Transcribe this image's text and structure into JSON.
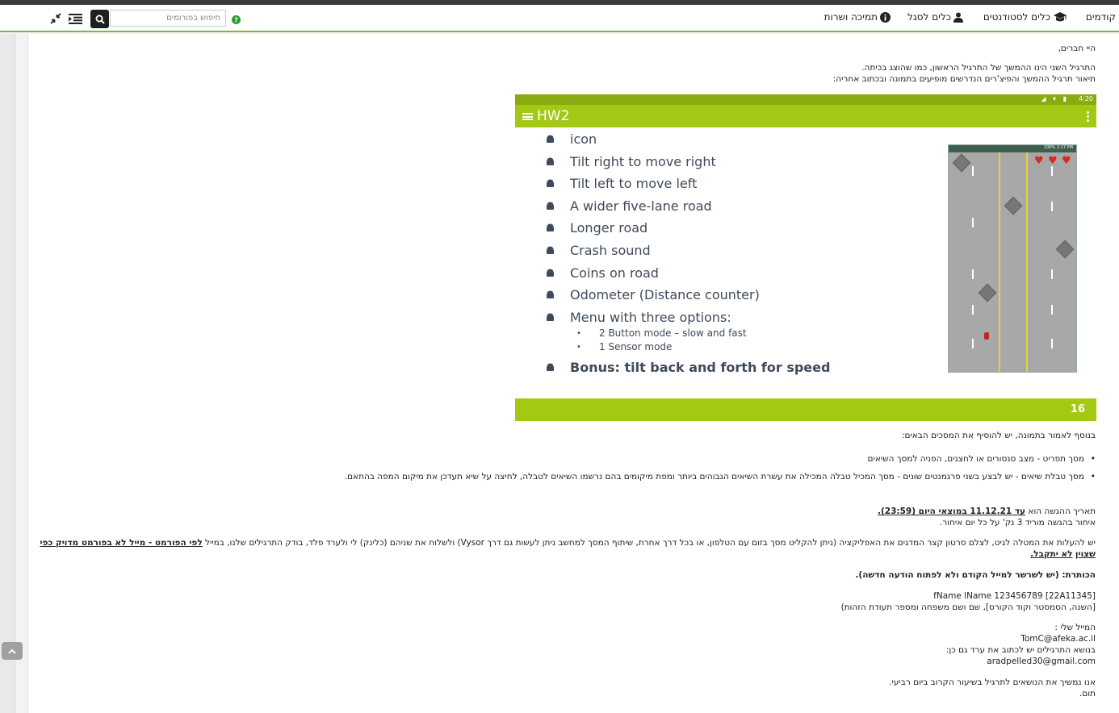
{
  "nav": {
    "items": [
      {
        "label": "קודמים"
      },
      {
        "label": "כלים לסטודנטים"
      },
      {
        "label": "כלים לסגל"
      },
      {
        "label": "תמיכה ושרות"
      }
    ],
    "search_placeholder": "חיפוש בפורומים"
  },
  "post": {
    "greeting": "היי חברים,",
    "intro_1": "התרגיל השני הינו ההמשך של התרגיל הראשון, כמו שהוצג בכיתה.",
    "intro_2": "תיאור תרגיל ההמשך והפיצ'רים הנדרשים מופיעים בתמונה ובכתוב אחריה:",
    "slide": {
      "status_time": "4:20",
      "title": "HW2",
      "bullets": [
        "icon",
        "Tilt right to move right",
        "Tilt left to move left",
        "A wider five-lane road",
        "Longer road",
        "Crash sound",
        "Coins on road",
        "Odometer (Distance counter)",
        "Menu with three options:"
      ],
      "sub_bullets": [
        "2 Button mode – slow and fast",
        "1 Sensor mode"
      ],
      "bonus": "Bonus: tilt back and forth for speed",
      "phone_status": "100% 2:17 PM",
      "page_number": "16"
    },
    "additional_intro": "בנוסף לאמור בתמונה, יש להוסיף את המסכים הבאים:",
    "list": [
      "מסך תפריט - מצב סנסורים או לחצנים, הפניה למסך השיאים",
      "מסך טבלת שיאים - יש לבצע בשני פרגמנטים שונים - מסך המכיל טבלה המכילה את עשרת השיאים הגבוהים ביותר ומפת מיקומים בהם נרשמו השיאים לטבלה, לחיצה על שיא תעדכן את מיקום המפה בהתאם."
    ],
    "deadline_prefix": "תאריך ההגשה הוא",
    "deadline_value": "עד 11.12.21 במוצאי היום (23:59).",
    "late_note": "איחור בהגשה מוריד 3 נק' על כל יום איחור.",
    "upload_text": "יש להעלות את המטלה לגיט, לצלם סרטון קצר המדגים את האפליקציה (ניתן להקליט מסך בזום עם הטלפון, או בכל דרך אחרת, שיתוף המסך למחשב ניתן לעשות גם דרך Vysor) ולשלוח את שניהם (כלינק) לי ולערד פלד, בודק התרגילים שלנו, במייל",
    "upload_emphasis": "לפי הפורמט - מייל לא בפורמט מדויק כפי שצוין",
    "upload_emphasis_2": "לא יתקבל.",
    "subject_heading": "הכותרת: (יש לשרשר למייל הקודם ולא לפתוח הודעה חדשה).",
    "subject_format": "fName lName 123456789 [22A11345]",
    "subject_explain": "[השנה, הסמסטר וקוד הקורס], שם ושם משפחה ומספר תעודת הזהות)",
    "my_email_label": "המייל שלי :",
    "my_email": "TomC@afeka.ac.il",
    "cc_label": "בנושא התרגילים יש לכתוב את ערד גם כן:",
    "cc_email": "aradpelled30@gmail.com",
    "closing": "אנו נמשיך את הנושאים לתרגיל בשיעור הקרוב ביום רביעי.",
    "signature": "תום."
  }
}
